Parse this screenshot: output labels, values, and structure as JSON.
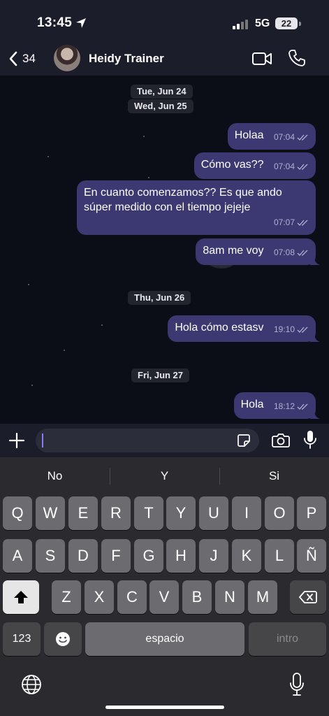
{
  "status_bar": {
    "time": "13:45",
    "network": "5G",
    "battery": "22"
  },
  "header": {
    "back_count": "34",
    "contact_name": "Heidy Trainer"
  },
  "chat": {
    "date_chips": [
      "Tue, Jun 24",
      "Wed, Jun 25",
      "Thu, Jun 26",
      "Fri, Jun 27"
    ],
    "messages": [
      {
        "text": "Holaa",
        "time": "07:04"
      },
      {
        "text": "Cómo vas??",
        "time": "07:04"
      },
      {
        "text": "En cuanto comenzamos?? Es que ando súper medido con el tiempo jejeje",
        "time": "07:07"
      },
      {
        "text": "8am me voy",
        "time": "07:08"
      },
      {
        "text": "Hola cómo estasv",
        "time": "19:10"
      },
      {
        "text": "Hola",
        "time": "18:12"
      }
    ]
  },
  "input": {
    "value": ""
  },
  "keyboard": {
    "suggestions": [
      "No",
      "Y",
      "Si"
    ],
    "row1": [
      "Q",
      "W",
      "E",
      "R",
      "T",
      "Y",
      "U",
      "I",
      "O",
      "P"
    ],
    "row2": [
      "A",
      "S",
      "D",
      "F",
      "G",
      "H",
      "J",
      "K",
      "L",
      "Ñ"
    ],
    "row3": [
      "Z",
      "X",
      "C",
      "V",
      "B",
      "N",
      "M"
    ],
    "numbers_label": "123",
    "space_label": "espacio",
    "return_label": "intro"
  },
  "colors": {
    "bubble": "#3b3872",
    "chat_background": "#0b0e16",
    "header_background": "#1c1d2a",
    "keyboard_background": "#2b2b2f"
  }
}
